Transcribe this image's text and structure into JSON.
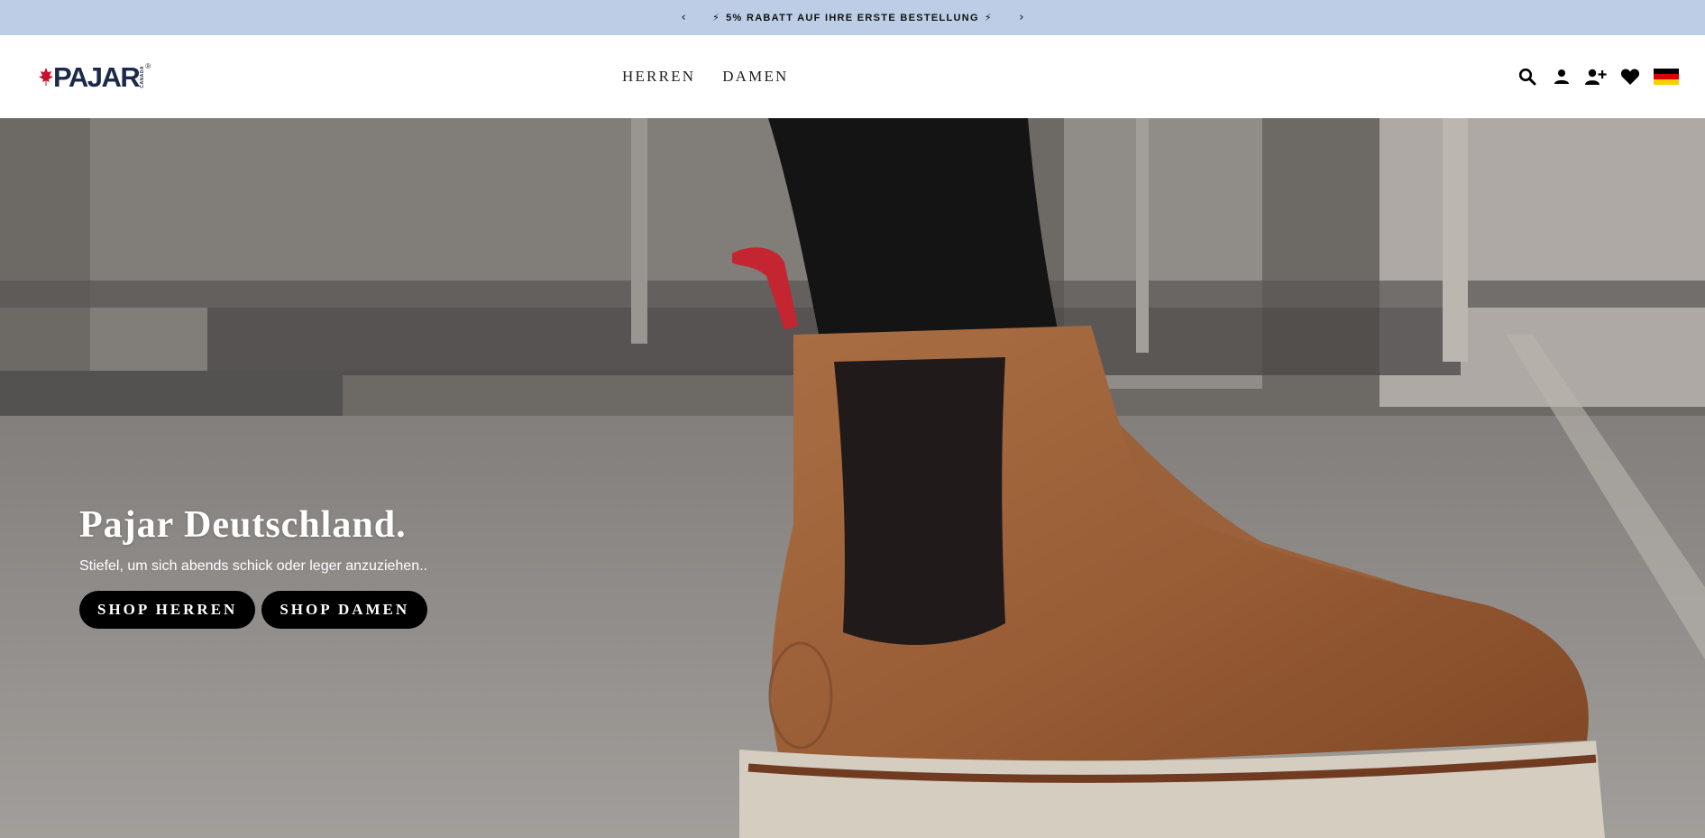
{
  "announcement": {
    "prev_label": "‹",
    "next_label": "›",
    "bolt": "⚡",
    "text": "5% RABATT AUF IHRE ERSTE BESTELLUNG"
  },
  "header": {
    "logo": {
      "text": "PAJAR",
      "sub": "CANADA",
      "reg": "®"
    },
    "nav": [
      {
        "label": "HERREN"
      },
      {
        "label": "DAMEN"
      }
    ],
    "icons": [
      "search-icon",
      "account-icon",
      "register-icon",
      "wishlist-icon",
      "germany-flag-icon"
    ],
    "flag_colors": [
      "#000000",
      "#dd0000",
      "#ffce00"
    ]
  },
  "hero": {
    "title": "Pajar Deutschland.",
    "subtitle": "Stiefel, um sich abends schick oder leger anzuziehen..",
    "buttons": [
      {
        "label": "SHOP HERREN"
      },
      {
        "label": "SHOP DAMEN"
      }
    ]
  },
  "colors": {
    "announcement_bg": "#bccde5",
    "logo_navy": "#1b2a4a",
    "logo_red": "#c8102e",
    "button_bg": "#000000",
    "boot_leather": "#a8673c"
  }
}
